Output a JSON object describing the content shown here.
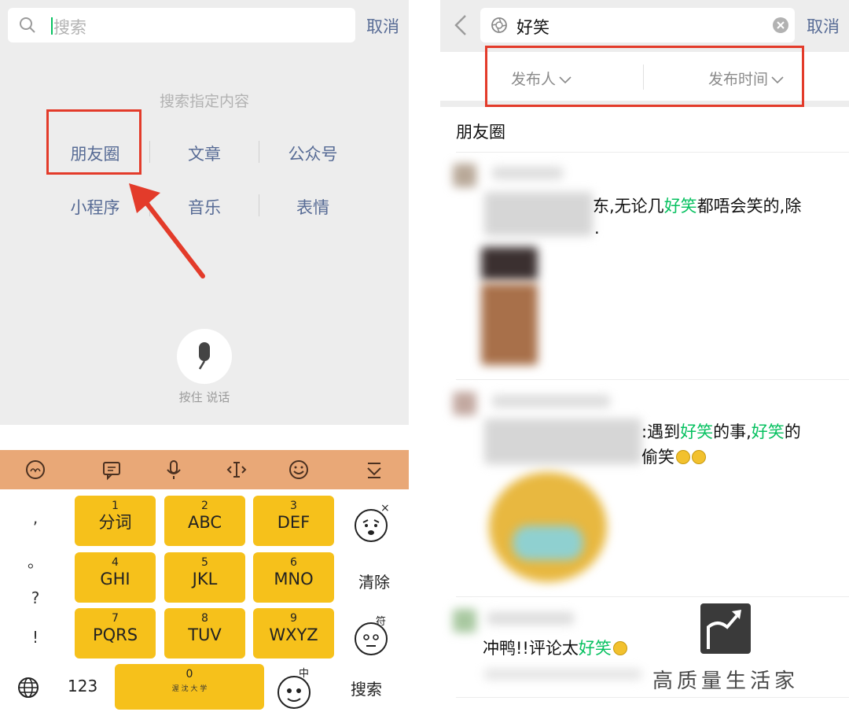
{
  "left": {
    "search_placeholder": "搜索",
    "cancel": "取消",
    "hint": "搜索指定内容",
    "categories": [
      "朋友圈",
      "文章",
      "公众号",
      "小程序",
      "音乐",
      "表情"
    ],
    "voice_label": "按住 说话",
    "keyboard": {
      "keys": [
        {
          "num": "1",
          "text": "分词"
        },
        {
          "num": "2",
          "text": "ABC"
        },
        {
          "num": "3",
          "text": "DEF"
        },
        {
          "num": "4",
          "text": "GHI"
        },
        {
          "num": "5",
          "text": "JKL"
        },
        {
          "num": "6",
          "text": "MNO"
        },
        {
          "num": "7",
          "text": "PQRS"
        },
        {
          "num": "8",
          "text": "TUV"
        },
        {
          "num": "9",
          "text": "WXYZ"
        }
      ],
      "space_num": "0",
      "space_logo_text": "渥 沈 大 学",
      "punct": [
        ",",
        "。",
        "?",
        "!"
      ],
      "clear": "清除",
      "num_toggle": "123",
      "search": "搜索",
      "face_marks": [
        "×",
        "符",
        "中"
      ]
    }
  },
  "right": {
    "query": "好笑",
    "cancel": "取消",
    "filters": [
      "发布人",
      "发布时间"
    ],
    "section": "朋友圈",
    "posts": [
      {
        "pre": "东,无论几",
        "hl": "好笑",
        "post": "都唔会笑的,除",
        "line2": "."
      },
      {
        "pre": ":遇到",
        "hl": "好笑",
        "mid": "的事,",
        "hl2": "好笑",
        "post": "的",
        "line2": "偷笑"
      },
      {
        "pre": "冲鸭!!评论太",
        "hl": "好笑",
        "post": ""
      }
    ],
    "watermark": "高质量生活家"
  }
}
